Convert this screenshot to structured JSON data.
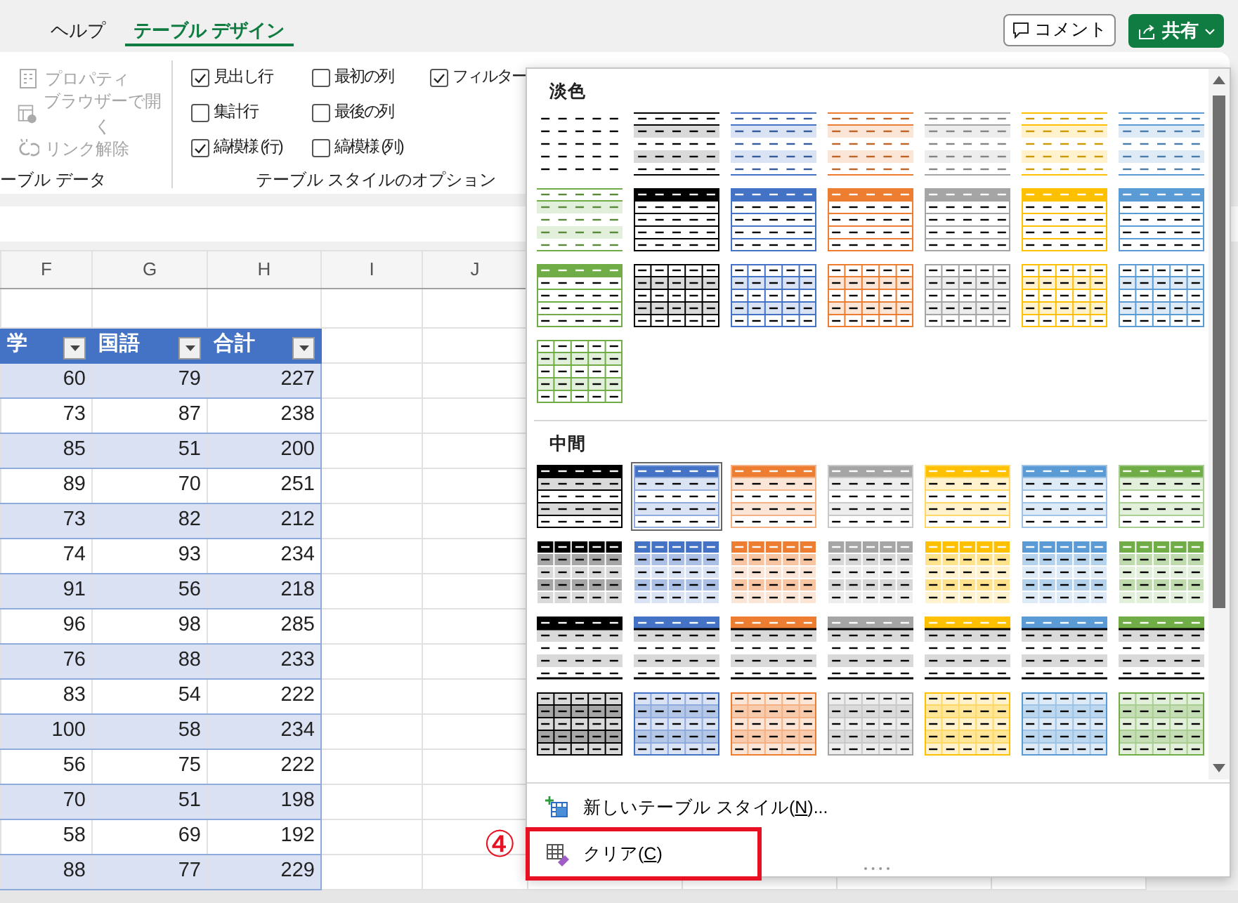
{
  "ribbon_tabs": [
    {
      "label": "ヘルプ",
      "selected": false
    },
    {
      "label": "テーブル デザイン",
      "selected": true
    }
  ],
  "comment_button": {
    "label": "コメント"
  },
  "share_button": {
    "label": "共有"
  },
  "table_data_group": {
    "label": "ーブル データ",
    "items": [
      {
        "kind": "properties",
        "label": "プロパティ",
        "disabled": true
      },
      {
        "kind": "browser",
        "label": "ブラウザーで開く",
        "disabled": true
      },
      {
        "kind": "unlink",
        "label": "リンク解除",
        "disabled": true
      }
    ]
  },
  "style_options_group": {
    "label": "テーブル スタイルのオプション",
    "columns": [
      {
        "options": [
          {
            "label": "見出し行",
            "checked": true
          },
          {
            "label": "集計行",
            "checked": false
          },
          {
            "label": "縞模様 (行)",
            "checked": true
          }
        ]
      },
      {
        "options": [
          {
            "label": "最初の列",
            "checked": false
          },
          {
            "label": "最後の列",
            "checked": false
          },
          {
            "label": "縞模様 (列)",
            "checked": false
          }
        ]
      },
      {
        "options": [
          {
            "label": "フィルター",
            "checked": true
          }
        ]
      }
    ]
  },
  "sheet": {
    "columns": [
      "F",
      "G",
      "H",
      "I",
      "J"
    ],
    "table": {
      "headers": [
        "学",
        "国語",
        "合計"
      ],
      "rows": [
        [
          "60",
          "79",
          "227"
        ],
        [
          "73",
          "87",
          "238"
        ],
        [
          "85",
          "51",
          "200"
        ],
        [
          "89",
          "70",
          "251"
        ],
        [
          "73",
          "82",
          "212"
        ],
        [
          "74",
          "93",
          "234"
        ],
        [
          "91",
          "56",
          "218"
        ],
        [
          "96",
          "98",
          "285"
        ],
        [
          "76",
          "88",
          "233"
        ],
        [
          "83",
          "54",
          "222"
        ],
        [
          "100",
          "58",
          "234"
        ],
        [
          "56",
          "75",
          "222"
        ],
        [
          "70",
          "51",
          "198"
        ],
        [
          "58",
          "69",
          "192"
        ],
        [
          "88",
          "77",
          "229"
        ]
      ]
    }
  },
  "style_gallery": {
    "sections": [
      {
        "title": "淡色",
        "styles": [
          {
            "kind": "plain",
            "selected": false
          },
          {
            "kind": "light-banded",
            "color": "#000000",
            "selected": false
          },
          {
            "kind": "light-banded",
            "color": "#4472c4",
            "selected": false
          },
          {
            "kind": "light-banded",
            "color": "#ed7d31",
            "selected": false
          },
          {
            "kind": "light-banded",
            "color": "#a5a5a5",
            "selected": false
          },
          {
            "kind": "light-banded",
            "color": "#ffc000",
            "selected": false
          },
          {
            "kind": "light-banded",
            "color": "#5b9bd5",
            "selected": false
          },
          {
            "kind": "light-banded",
            "color": "#70ad47",
            "selected": false
          },
          {
            "kind": "light-header",
            "color": "#000000",
            "selected": false
          },
          {
            "kind": "light-header",
            "color": "#4472c4",
            "selected": false
          },
          {
            "kind": "light-header",
            "color": "#ed7d31",
            "selected": false
          },
          {
            "kind": "light-header",
            "color": "#a5a5a5",
            "selected": false
          },
          {
            "kind": "light-header",
            "color": "#ffc000",
            "selected": false
          },
          {
            "kind": "light-header",
            "color": "#5b9bd5",
            "selected": false
          },
          {
            "kind": "light-header",
            "color": "#70ad47",
            "selected": false
          },
          {
            "kind": "light-grid",
            "color": "#000000",
            "selected": false
          },
          {
            "kind": "light-grid",
            "color": "#4472c4",
            "selected": false
          },
          {
            "kind": "light-grid",
            "color": "#ed7d31",
            "selected": false
          },
          {
            "kind": "light-grid",
            "color": "#a5a5a5",
            "selected": false
          },
          {
            "kind": "light-grid",
            "color": "#ffc000",
            "selected": false
          },
          {
            "kind": "light-grid",
            "color": "#5b9bd5",
            "selected": false
          },
          {
            "kind": "light-grid",
            "color": "#70ad47",
            "selected": false
          }
        ]
      },
      {
        "title": "中間",
        "styles": [
          {
            "kind": "medium-banded",
            "color": "#000000",
            "selected": false
          },
          {
            "kind": "medium-banded",
            "color": "#4472c4",
            "selected": true
          },
          {
            "kind": "medium-banded",
            "color": "#ed7d31",
            "selected": false
          },
          {
            "kind": "medium-banded",
            "color": "#a5a5a5",
            "selected": false
          },
          {
            "kind": "medium-banded",
            "color": "#ffc000",
            "selected": false
          },
          {
            "kind": "medium-banded",
            "color": "#5b9bd5",
            "selected": false
          },
          {
            "kind": "medium-banded",
            "color": "#70ad47",
            "selected": false
          },
          {
            "kind": "medium-solid",
            "color": "#000000",
            "selected": false
          },
          {
            "kind": "medium-solid",
            "color": "#4472c4",
            "selected": false
          },
          {
            "kind": "medium-solid",
            "color": "#ed7d31",
            "selected": false
          },
          {
            "kind": "medium-solid",
            "color": "#a5a5a5",
            "selected": false
          },
          {
            "kind": "medium-solid",
            "color": "#ffc000",
            "selected": false
          },
          {
            "kind": "medium-solid",
            "color": "#5b9bd5",
            "selected": false
          },
          {
            "kind": "medium-solid",
            "color": "#70ad47",
            "selected": false
          },
          {
            "kind": "medium-underline",
            "color": "#000000",
            "selected": false
          },
          {
            "kind": "medium-underline",
            "color": "#4472c4",
            "selected": false
          },
          {
            "kind": "medium-underline",
            "color": "#ed7d31",
            "selected": false
          },
          {
            "kind": "medium-underline",
            "color": "#a5a5a5",
            "selected": false
          },
          {
            "kind": "medium-underline",
            "color": "#ffc000",
            "selected": false
          },
          {
            "kind": "medium-underline",
            "color": "#5b9bd5",
            "selected": false
          },
          {
            "kind": "medium-underline",
            "color": "#70ad47",
            "selected": false
          },
          {
            "kind": "medium-grid",
            "color": "#000000",
            "selected": false
          },
          {
            "kind": "medium-grid",
            "color": "#4472c4",
            "selected": false
          },
          {
            "kind": "medium-grid",
            "color": "#ed7d31",
            "selected": false
          },
          {
            "kind": "medium-grid",
            "color": "#a5a5a5",
            "selected": false
          },
          {
            "kind": "medium-grid",
            "color": "#ffc000",
            "selected": false
          },
          {
            "kind": "medium-grid",
            "color": "#5b9bd5",
            "selected": false
          },
          {
            "kind": "medium-grid",
            "color": "#70ad47",
            "selected": false
          }
        ]
      }
    ],
    "menu_items": [
      {
        "kind": "new-style",
        "text_before": "新しいテーブル スタイル(",
        "access_key": "N",
        "text_after": ")...",
        "highlighted": false
      },
      {
        "kind": "clear",
        "text_before": "クリア(",
        "access_key": "C",
        "text_after": ")",
        "highlighted": true
      }
    ]
  },
  "annotation": {
    "step": "④"
  }
}
